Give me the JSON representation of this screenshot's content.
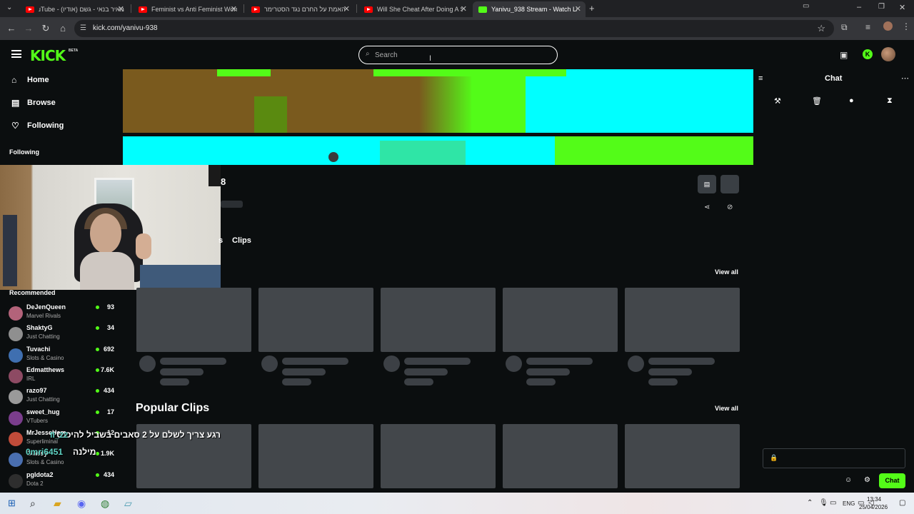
{
  "browser": {
    "tabs": [
      {
        "title": "מאיר בנאי - גשם (אודיו) - uTube",
        "icon": "youtube-icon"
      },
      {
        "title": "Feminist vs Anti Feminist Wome",
        "icon": "youtube-icon"
      },
      {
        "title": "האמת על החרם נגד הסטרימר",
        "icon": "youtube-icon"
      },
      {
        "title": "Will She Cheat After Doing A S",
        "icon": "youtube-icon"
      },
      {
        "title": "Yanivu_938 Stream - Watch Live",
        "icon": "kick-icon"
      }
    ],
    "url": "kick.com/yanivu-938"
  },
  "header": {
    "logo": "KICK",
    "logo_badge": "BETA",
    "search_placeholder": "Search"
  },
  "sidebar": {
    "nav": [
      {
        "label": "Home",
        "icon": "home-icon"
      },
      {
        "label": "Browse",
        "icon": "browse-icon"
      },
      {
        "label": "Following",
        "icon": "heart-icon"
      }
    ],
    "following_header": "Following",
    "recommended_header": "Recommended",
    "recommended": [
      {
        "name": "DeJenQueen",
        "category": "Marvel Rivals",
        "viewers": "93",
        "color": "#b3637a"
      },
      {
        "name": "ShaktyG",
        "category": "Just Chatting",
        "viewers": "34",
        "color": "#8f8f8f"
      },
      {
        "name": "Tuvachi",
        "category": "Slots & Casino",
        "viewers": "692",
        "color": "#3f6fb0"
      },
      {
        "name": "Edmatthews",
        "category": "IRL",
        "viewers": "7.6K",
        "color": "#8d4a63"
      },
      {
        "name": "razo97",
        "category": "Just Chatting",
        "viewers": "434",
        "color": "#9a9a9a"
      },
      {
        "name": "sweet_hug",
        "category": "VTubers",
        "viewers": "17",
        "color": "#7a3d8c"
      },
      {
        "name": "MrJesseHam",
        "category": "Superliminal",
        "viewers": "12",
        "color": "#c04c3a"
      },
      {
        "name": "Glassy",
        "category": "Slots & Casino",
        "viewers": "1.9K",
        "color": "#4a6fb0"
      },
      {
        "name": "pgldota2",
        "category": "Dota 2",
        "viewers": "434",
        "color": "#2e2e2e"
      }
    ]
  },
  "channel": {
    "name_visible": "8",
    "tabs": {
      "partial": "s",
      "clips": "Clips"
    },
    "view_all": "View all",
    "popular_clips": "Popular Clips"
  },
  "overlay": {
    "user1": "fl_22",
    "message1": "רגע צריך לשלם על 2 סאבים בשביל להיכנס?",
    "user2": "0mri6451",
    "message2": "מילנה"
  },
  "chat": {
    "title": "Chat",
    "send_label": "Chat"
  },
  "taskbar": {
    "lang": "ENG",
    "time": "13:34",
    "date": "25/04/2026"
  },
  "colors": {
    "accent": "#53fc18",
    "background": "#0b0e0f",
    "skeleton": "#43474b"
  }
}
